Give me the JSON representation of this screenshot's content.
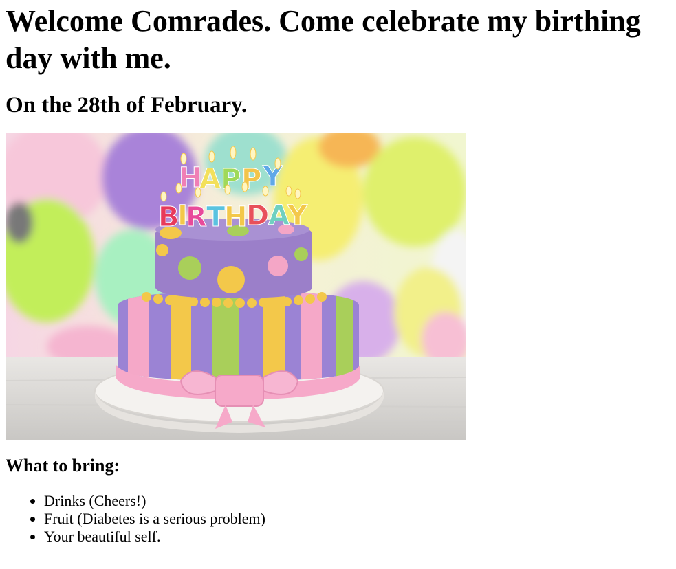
{
  "page": {
    "title": "Welcome Comrades. Come celebrate my birthing day with me.",
    "date_heading": "On the 28th of February.",
    "image": {
      "alt": "birthday cake",
      "cake_text_line1": "HAPPY",
      "cake_text_line2": "BIRTHDAY"
    },
    "bring_heading": "What to bring:",
    "bring_items": [
      "Drinks (Cheers!)",
      "Fruit (Diabetes is a serious problem)",
      "Your beautiful self."
    ]
  },
  "colors": {
    "text": "#000000",
    "background": "#ffffff",
    "cake_top": "#9b7fc9",
    "ribbon_pink": "#f4a6c6",
    "dot_yellow": "#f3c84a",
    "stripe_green": "#a9cf5a"
  }
}
